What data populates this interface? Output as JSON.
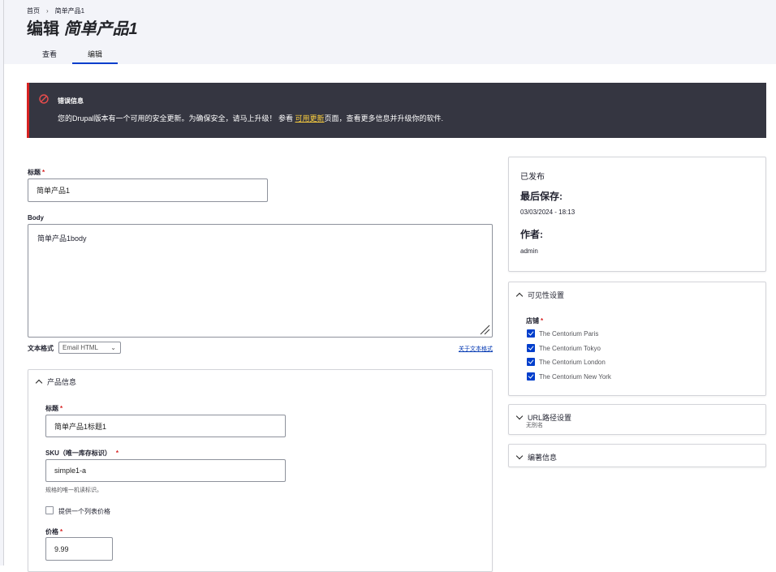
{
  "breadcrumb": {
    "home": "首页",
    "sep": "›",
    "current": "简单产品1"
  },
  "title": {
    "prefix": "编辑",
    "name": "简单产品1"
  },
  "tabs": [
    {
      "label": "查看"
    },
    {
      "label": "编辑"
    }
  ],
  "error": {
    "title": "错误信息",
    "text_before": "您的Drupal版本有一个可用的安全更新。为确保安全，请马上升级！ 参看",
    "link": "可用更新",
    "text_after": "页面，查看更多信息并升级你的软件."
  },
  "form": {
    "title_label": "标题",
    "title_value": "简单产品1",
    "body_label": "Body",
    "body_value": "简单产品1body",
    "format_label": "文本格式",
    "format_value": "Email HTML",
    "format_link": "关于文本格式"
  },
  "product": {
    "header": "产品信息",
    "title_label": "标题",
    "title_value": "简单产品1标题1",
    "sku_label": "SKU（唯一库存标识）",
    "sku_value": "simple1-a",
    "sku_desc": "规格的唯一机读标识。",
    "list_price_label": "提供一个列表价格",
    "price_label": "价格",
    "price_value": "9.99"
  },
  "meta": {
    "status": "已发布",
    "last_saved_label": "最后保存:",
    "last_saved_value": "03/03/2024 - 18:13",
    "author_label": "作者:",
    "author_value": "admin"
  },
  "visibility": {
    "header": "可见性设置",
    "stores_label": "店铺",
    "stores": [
      {
        "name": "The Centorium Paris"
      },
      {
        "name": "The Centorium Tokyo"
      },
      {
        "name": "The Centorium London"
      },
      {
        "name": "The Centorium New York"
      }
    ]
  },
  "url_settings": {
    "header": "URL路径设置",
    "sub": "无别名"
  },
  "authoring": {
    "header": "编著信息"
  },
  "colors": {
    "accent": "#003ecc",
    "error_bg": "#353641",
    "error_border": "#d72222",
    "link_yellow": "#ffd23f"
  }
}
